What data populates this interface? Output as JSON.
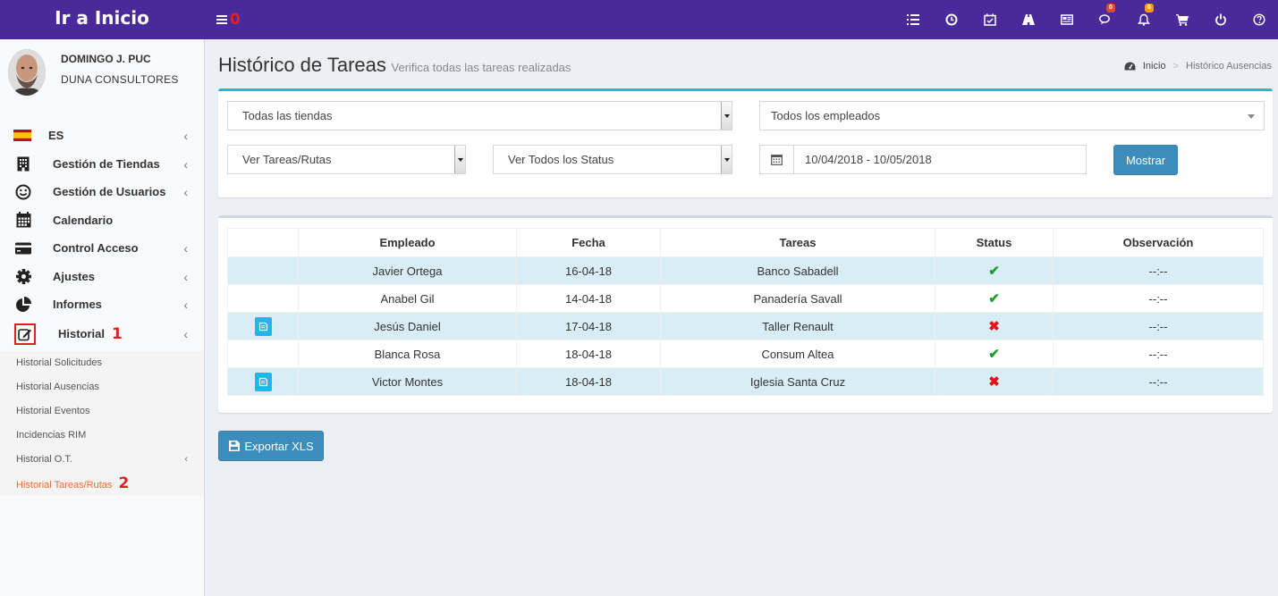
{
  "header": {
    "brand": "Ir a Inicio",
    "toggle_marker": "0",
    "icons": [
      {
        "name": "list-icon"
      },
      {
        "name": "clock-icon"
      },
      {
        "name": "calendar-check-icon"
      },
      {
        "name": "road-icon"
      },
      {
        "name": "newspaper-icon"
      },
      {
        "name": "comments-icon",
        "badge": "0",
        "badge_color": "#dd4b39"
      },
      {
        "name": "bell-icon",
        "badge": "0",
        "badge_color": "#f39c12"
      },
      {
        "name": "cart-icon"
      },
      {
        "name": "power-icon"
      },
      {
        "name": "help-icon"
      }
    ],
    "bg_color": "#4a2a9a"
  },
  "user": {
    "name": "DOMINGO J. PUC",
    "company": "DUNA CONSULTORES"
  },
  "sidebar": {
    "items": [
      {
        "label": "ES",
        "icon": "spain-flag-icon",
        "chevron": "‹"
      },
      {
        "label": "Gestión de Tiendas",
        "icon": "building-icon",
        "chevron": "‹"
      },
      {
        "label": "Gestión de Usuarios",
        "icon": "smile-icon",
        "chevron": "‹"
      },
      {
        "label": "Calendario",
        "icon": "calendar-icon",
        "chevron": ""
      },
      {
        "label": "Control Acceso",
        "icon": "credit-card-icon",
        "chevron": "‹"
      },
      {
        "label": "Ajustes",
        "icon": "gear-icon",
        "chevron": "‹"
      },
      {
        "label": "Informes",
        "icon": "pie-chart-icon",
        "chevron": "‹"
      },
      {
        "label": "Historial",
        "icon": "edit-icon",
        "chevron": "‹",
        "marker": "1"
      }
    ],
    "submenu": [
      {
        "label": "Historial Solicitudes"
      },
      {
        "label": "Historial Ausencias"
      },
      {
        "label": "Historial Eventos"
      },
      {
        "label": "Incidencias RIM"
      },
      {
        "label": "Historial O.T.",
        "chevron": "‹"
      },
      {
        "label": "Historial Tareas/Rutas",
        "marker": "2"
      }
    ]
  },
  "page": {
    "title": "Histórico de Tareas",
    "subtitle": "Verifica todas las tareas realizadas",
    "breadcrumb": [
      "Inicio",
      "Histórico Ausencias"
    ],
    "breadcrumb_sep": ">"
  },
  "filters": {
    "store": "Todas las tiendas",
    "employee": "Todos los empleados",
    "type": "Ver Tareas/Rutas",
    "status": "Ver Todos los Status",
    "date_range": "10/04/2018 - 10/05/2018",
    "submit_label": "Mostrar"
  },
  "table": {
    "headers": [
      "",
      "Empleado",
      "Fecha",
      "Tareas",
      "Status",
      "Observación"
    ],
    "rows": [
      {
        "note": false,
        "employee": "Javier Ortega",
        "date": "16-04-18",
        "task": "Banco Sabadell",
        "status": "ok",
        "obs": "--:--"
      },
      {
        "note": false,
        "employee": "Anabel Gil",
        "date": "14-04-18",
        "task": "Panadería Savall",
        "status": "ok",
        "obs": "--:--"
      },
      {
        "note": true,
        "employee": "Jesús Daniel",
        "date": "17-04-18",
        "task": "Taller Renault",
        "status": "fail",
        "obs": "--:--"
      },
      {
        "note": false,
        "employee": "Blanca Rosa",
        "date": "18-04-18",
        "task": "Consum Altea",
        "status": "ok",
        "obs": "--:--"
      },
      {
        "note": true,
        "employee": "Victor Montes",
        "date": "18-04-18",
        "task": "Iglesia Santa Cruz",
        "status": "fail",
        "obs": "--:--"
      }
    ],
    "status_symbols": {
      "ok": "✔",
      "fail": "✖"
    }
  },
  "export": {
    "label": "Exportar XLS"
  }
}
